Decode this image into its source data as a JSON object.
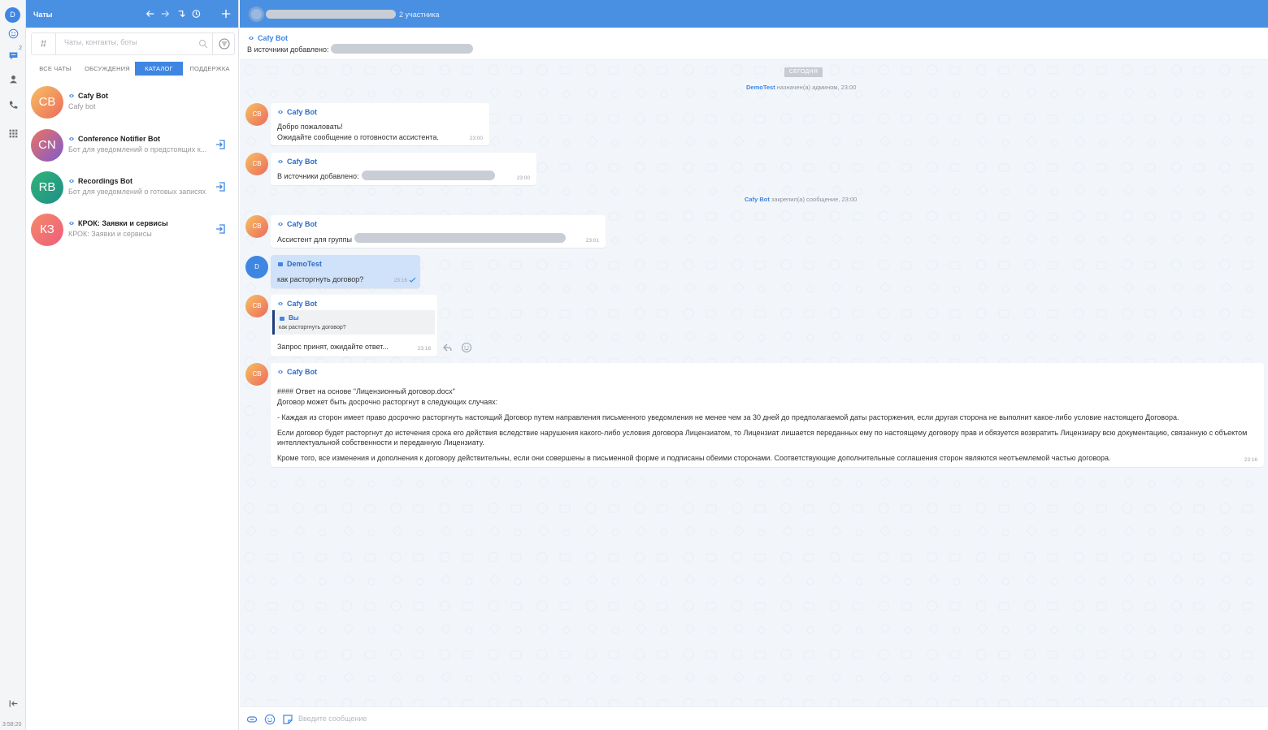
{
  "rail": {
    "user_initial": "D",
    "messages_badge": "2",
    "clock": "3:58:20"
  },
  "left": {
    "title": "Чаты",
    "search_hash": "#",
    "search_placeholder": "Чаты, контакты, боты",
    "tabs": [
      {
        "label": "ВСЕ ЧАТЫ",
        "active": false
      },
      {
        "label": "ОБСУЖДЕНИЯ",
        "active": false
      },
      {
        "label": "КАТАЛОГ",
        "active": true
      },
      {
        "label": "ПОДДЕРЖКА",
        "active": false
      }
    ],
    "chats": [
      {
        "initials": "CB",
        "name": "Cafy Bot",
        "subtitle": "Cafy bot",
        "color": "#f0a04b"
      },
      {
        "initials": "CN",
        "name": "Conference Notifier Bot",
        "subtitle": "Бот для уведомлений о предстоящих к...",
        "color": "#a06cc2"
      },
      {
        "initials": "RB",
        "name": "Recordings Bot",
        "subtitle": "Бот для уведомлений о готовых записях",
        "color": "#2aa07a"
      },
      {
        "initials": "КЗ",
        "name": "КРОК: Заявки и сервисы",
        "subtitle": "КРОК: Заявки и сервисы",
        "color": "#f26d6d"
      }
    ]
  },
  "chat": {
    "members": "2 участника",
    "pinned": {
      "sender": "Cafy Bot",
      "text": "В источники добавлено:"
    },
    "date_chip": "СЕГОДНЯ",
    "sys1": {
      "name": "DemoTest",
      "text": " назначен(а) админом, 23:00"
    },
    "sys2": {
      "name": "Cafy Bot",
      "text": " закрепил(а) сообщение, 23:00"
    },
    "messages": [
      {
        "sender": "Cafy Bot",
        "initials": "CB",
        "line1": "Добро пожаловать!",
        "line2": "Ожидайте сообщение о готовности ассистента.",
        "time": "23:00"
      },
      {
        "sender": "Cafy Bot",
        "initials": "CB",
        "line1": "В источники добавлено:",
        "time": "23:00"
      },
      {
        "sender": "Cafy Bot",
        "initials": "CB",
        "line1": "Ассистент для группы",
        "time": "23:01"
      },
      {
        "sender": "DemoTest",
        "initials": "D",
        "line1": "как расторгнуть договор?",
        "time": "23:16"
      },
      {
        "sender": "Cafy Bot",
        "initials": "CB",
        "quote_name": "Вы",
        "quote_text": "как расторгнуть договор?",
        "line1": "Запрос принят, ожидайте ответ...",
        "time": "23:16"
      },
      {
        "sender": "Cafy Bot",
        "initials": "CB",
        "time": "23:16",
        "p1": "#### Ответ на основе \"Лицензионный договор.docx\"",
        "p2": "Договор может быть досрочно расторгнут в следующих случаях:",
        "p3": "- Каждая из сторон имеет право досрочно расторгнуть настоящий Договор путем направления письменного уведомления не менее чем за 30 дней до предполагаемой даты расторжения, если другая сторона не выполнит какое-либо условие настоящего Договора.",
        "p4": "Если договор будет расторгнут до истечения срока его действия вследствие нарушения какого-либо условия договора Лицензиатом, то Лицензиат лишается переданных ему по настоящему договору прав и обязуется возвратить Лицензиару всю документацию, связанную с объектом интеллектуальной собственности и переданную Лицензиату.",
        "p5": "Кроме того, все изменения и дополнения к договору действительны, если они совершены в письменной форме и подписаны обеими сторонами. Соответствующие дополнительные соглашения сторон являются неотъемлемой частью договора."
      }
    ],
    "composer_placeholder": "Введите сообщение"
  }
}
